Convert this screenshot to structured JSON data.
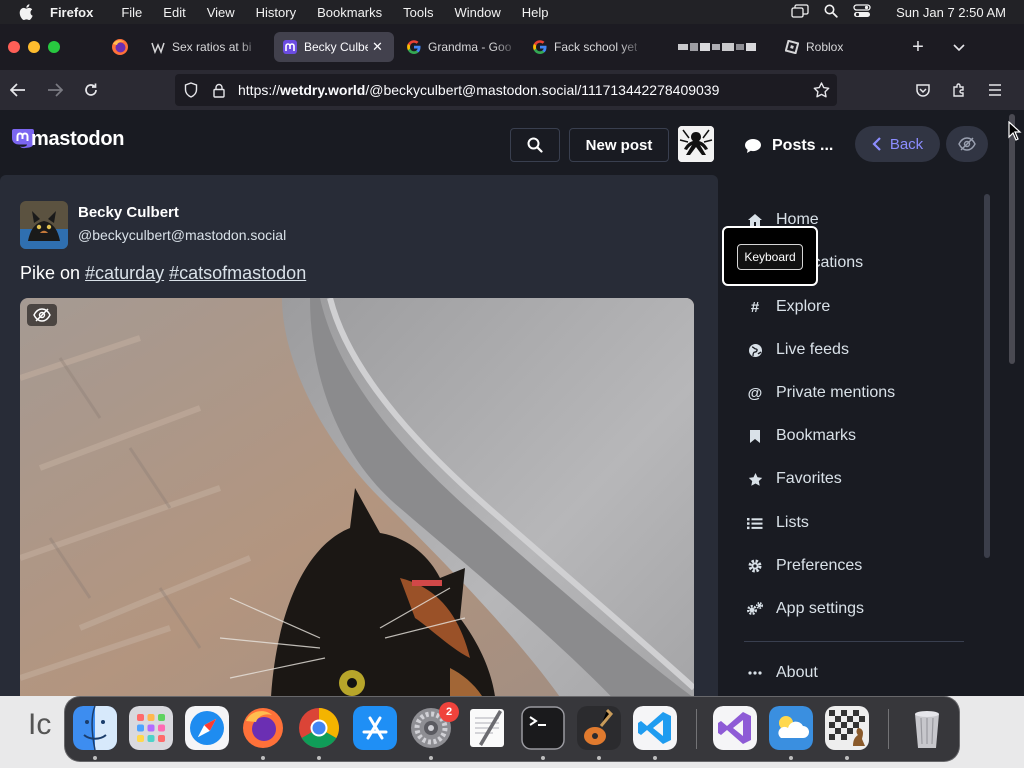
{
  "menubar": {
    "app_name": "Firefox",
    "items": [
      "File",
      "Edit",
      "View",
      "History",
      "Bookmarks",
      "Tools",
      "Window",
      "Help"
    ],
    "clock": "Sun Jan 7  2:50 AM"
  },
  "browser": {
    "tabs": [
      {
        "title": "Sex ratios at bi",
        "icon": "wikipedia-icon"
      },
      {
        "title": "Becky Culber",
        "icon": "mastodon-icon",
        "active": true
      },
      {
        "title": "Grandma - Goo",
        "icon": "google-icon"
      },
      {
        "title": "Fack school yet",
        "icon": "google-icon"
      },
      {
        "title": "Roblox",
        "icon": "roblox-icon"
      }
    ],
    "url_scheme": "https://",
    "url_host": "wetdry.world",
    "url_path": "/@beckyculbert@mastodon.social/111713442278409039"
  },
  "mastodon": {
    "logo_text": "mastodon",
    "new_post_label": "New post",
    "post": {
      "display_name": "Becky Culbert",
      "acct": "@beckyculbert@mastodon.social",
      "text_lead": "Pike on ",
      "tags": [
        "#caturday",
        "#catsofmastodon"
      ]
    },
    "column_header": {
      "title": "Posts ...",
      "back_label": "Back"
    },
    "nav": [
      {
        "label": "Home",
        "icon": "home-icon"
      },
      {
        "label": "Notifications",
        "icon": "bell-icon"
      },
      {
        "label": "Explore",
        "icon": "hashtag-icon"
      },
      {
        "label": "Live feeds",
        "icon": "globe-icon"
      },
      {
        "label": "Private mentions",
        "icon": "at-icon"
      },
      {
        "label": "Bookmarks",
        "icon": "bookmark-icon"
      },
      {
        "label": "Favorites",
        "icon": "star-icon"
      },
      {
        "label": "Lists",
        "icon": "list-icon"
      },
      {
        "label": "Preferences",
        "icon": "gear-icon"
      },
      {
        "label": "App settings",
        "icon": "gears-icon"
      },
      {
        "label": "About",
        "icon": "ellipsis-icon"
      }
    ],
    "tooltip_label": "Keyboard"
  },
  "desktop_fragment": "Ic",
  "dock": {
    "apps": [
      "Finder",
      "Launchpad",
      "Safari",
      "Firefox",
      "Chrome",
      "App Store",
      "System Settings",
      "TextEdit",
      "Terminal",
      "GarageBand",
      "Visual Studio Code",
      "Visual Studio",
      "Weather",
      "Chess",
      "Trash"
    ],
    "settings_badge": "2"
  },
  "colors": {
    "accent": "#8c8dff",
    "page_bg": "#191b22",
    "column_bg": "#282c37",
    "text": "#d9e1e8"
  }
}
